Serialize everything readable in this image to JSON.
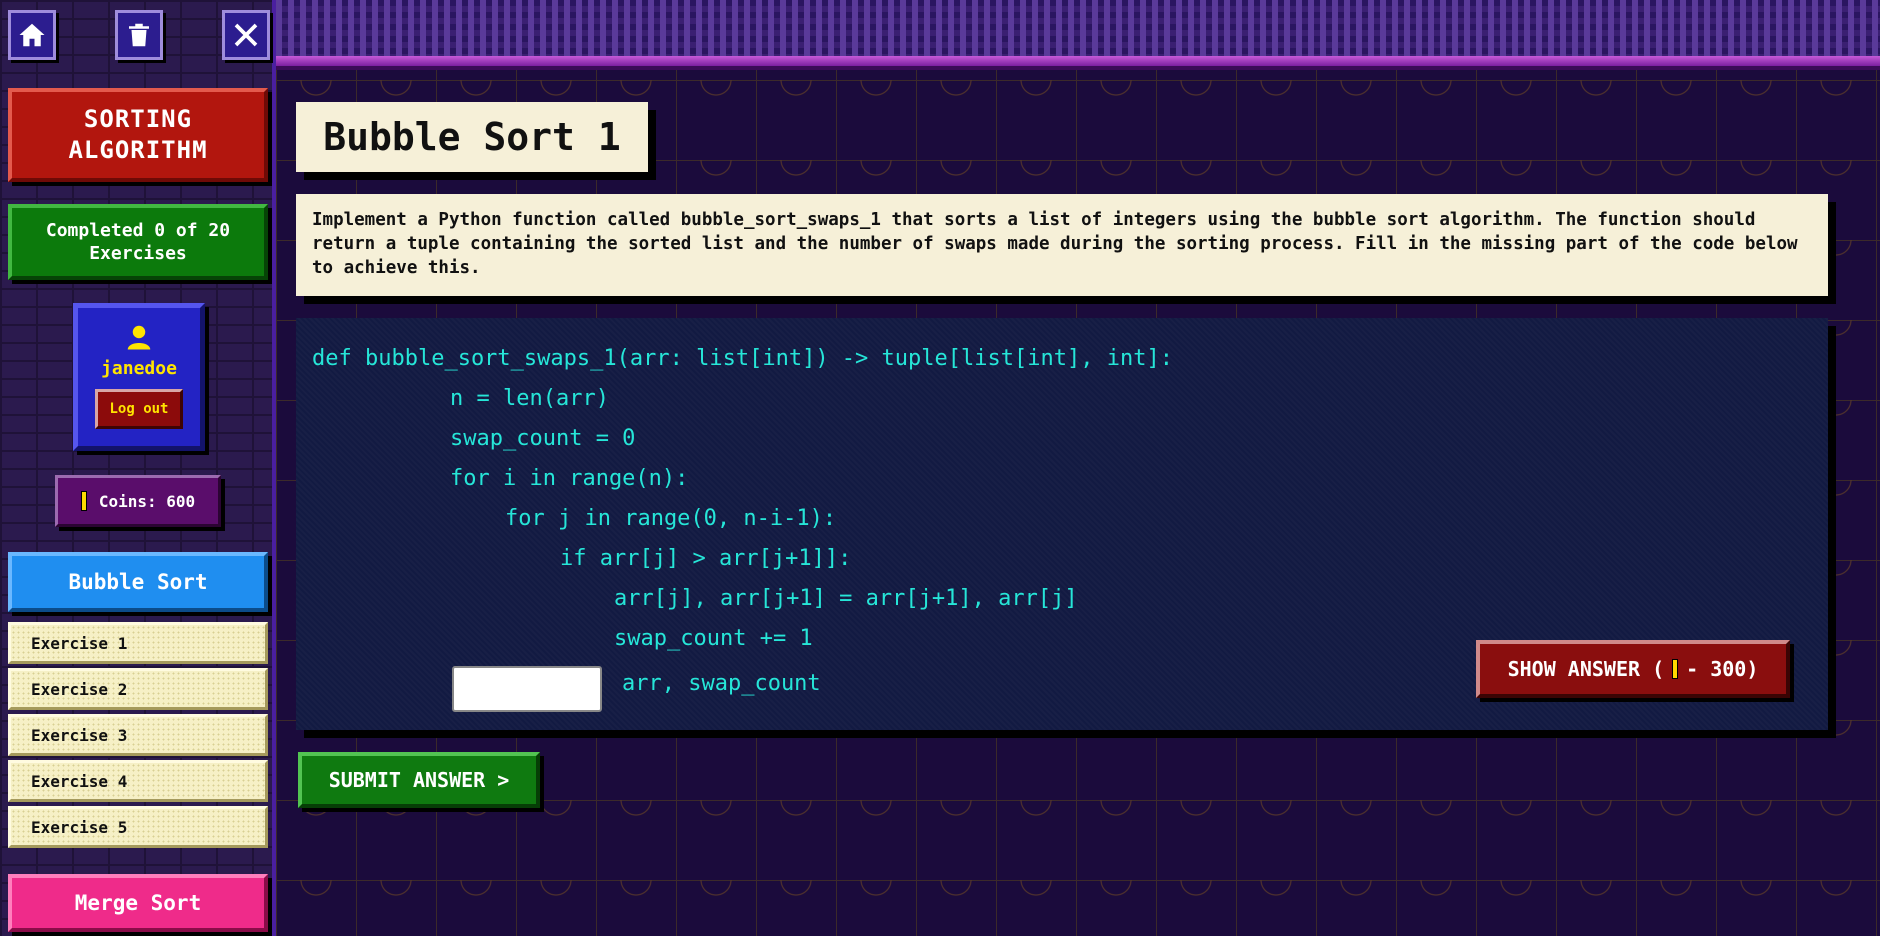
{
  "sidebar": {
    "title": "SORTING ALGORITHM",
    "progress": "Completed 0 of 20 Exercises",
    "user": {
      "name": "janedoe",
      "logout": "Log out"
    },
    "coins": "Coins: 600",
    "topics": [
      "Bubble Sort",
      "Merge Sort"
    ],
    "exercises": [
      "Exercise 1",
      "Exercise 2",
      "Exercise 3",
      "Exercise 4",
      "Exercise 5"
    ],
    "icons": [
      "home-icon",
      "trash-icon",
      "close-icon"
    ]
  },
  "main": {
    "title": "Bubble Sort 1",
    "description": "Implement a Python function called bubble_sort_swaps_1 that sorts a list of integers using the bubble sort algorithm. The function should return a tuple containing the sorted list and the number of swaps made during the sorting process. Fill in the missing part of the code below to achieve this.",
    "code": [
      "def bubble_sort_swaps_1(arr: list[int]) -> tuple[list[int], int]:",
      "n = len(arr)",
      "swap_count = 0",
      "for i in range(n):",
      "for j in range(0, n-i-1):",
      "if arr[j] > arr[j+1]]:",
      "arr[j], arr[j+1] = arr[j+1], arr[j]",
      "swap_count += 1",
      "arr, swap_count"
    ],
    "answer_value": "",
    "show_answer": {
      "label_prefix": "SHOW ANSWER (",
      "label_suffix": "- 300)"
    },
    "submit": "SUBMIT ANSWER >"
  },
  "colors": {
    "code_text": "#26e6d8",
    "coin": "#ffd800",
    "title_red": "#b2160e",
    "progress_green": "#0c7a0c",
    "bubble_blue": "#1f8ef0",
    "merge_pink": "#ef2b8a"
  }
}
